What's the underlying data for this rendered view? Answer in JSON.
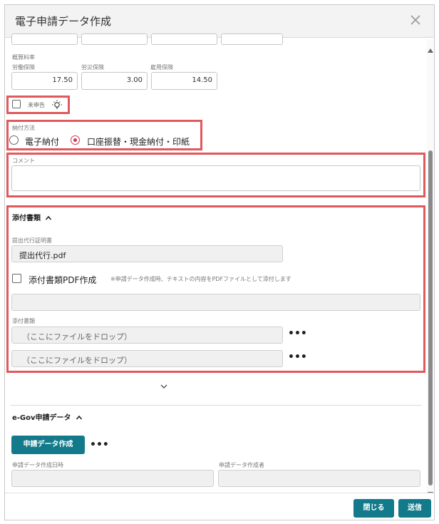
{
  "dialog": {
    "title": "電子申請データ作成",
    "close_icon": "close-icon"
  },
  "rates": {
    "section_label": "概算料率",
    "labor_label": "労働保険",
    "labor_value": "17.50",
    "accident_label": "労災保険",
    "accident_value": "3.00",
    "employment_label": "雇用保険",
    "employment_value": "14.50"
  },
  "undeclared": {
    "label": "未申告",
    "icon": "lightbulb-icon",
    "checked": false
  },
  "payment": {
    "label": "納付方法",
    "options": [
      "電子納付",
      "口座振替・現金納付・印紙"
    ],
    "selected": "口座振替・現金納付・印紙"
  },
  "comment": {
    "label": "コメント",
    "value": ""
  },
  "attachments": {
    "header": "添付書類",
    "proxy_label": "提出代行証明書",
    "proxy_file": "提出代行.pdf",
    "pdf_checkbox_label": "添付書類PDF作成",
    "pdf_note": "※申請データ作成時、テキストの内容をPDFファイルとして添付します",
    "pdf_text_value": "",
    "files_label": "添付書類",
    "drop_placeholders": [
      "（ここにファイルをドロップ）",
      "（ここにファイルをドロップ）"
    ],
    "more_label": "•••"
  },
  "egov": {
    "header": "e-Gov申請データ",
    "create_button": "申請データ作成",
    "more_label": "•••",
    "created_at_label": "申請データ作成日時",
    "created_at_value": "",
    "created_by_label": "申請データ作成者",
    "created_by_value": ""
  },
  "footer": {
    "close_button": "閉じる",
    "send_button": "送信"
  },
  "colors": {
    "accent": "#127a8a",
    "highlight": "#e0595c",
    "radio_selected": "#d9314d"
  }
}
